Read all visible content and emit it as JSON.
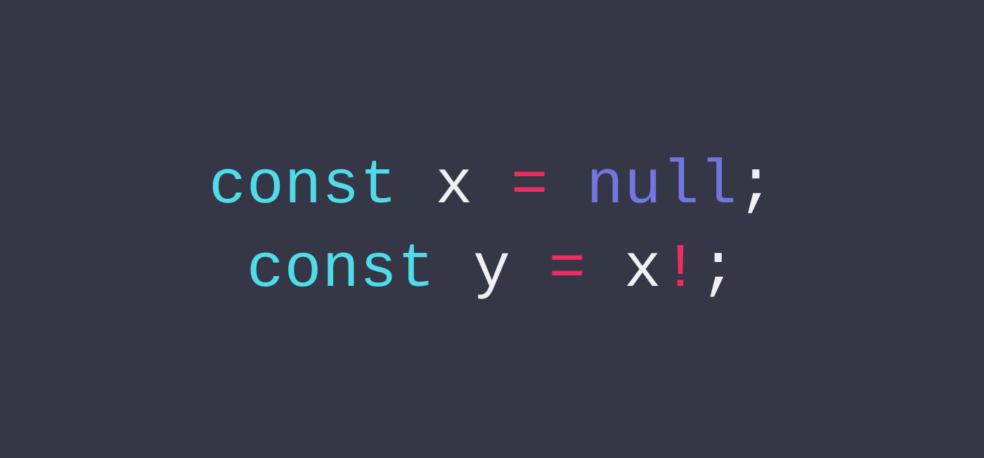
{
  "code": {
    "line1": {
      "keyword": "const",
      "space1": " ",
      "identifier": "x",
      "space2": " ",
      "operator": "=",
      "space3": " ",
      "value": "null",
      "semicolon": ";"
    },
    "line2": {
      "keyword": "const",
      "space1": " ",
      "identifier": "y",
      "space2": " ",
      "operator": "=",
      "space3": " ",
      "ref": "x",
      "assertion": "!",
      "semicolon": ";"
    }
  },
  "colors": {
    "background": "#353746",
    "keyword": "#4fdce8",
    "identifier": "#f0eff2",
    "operator": "#ef2d63",
    "null": "#7177e0",
    "punctuation": "#f0eff2"
  }
}
